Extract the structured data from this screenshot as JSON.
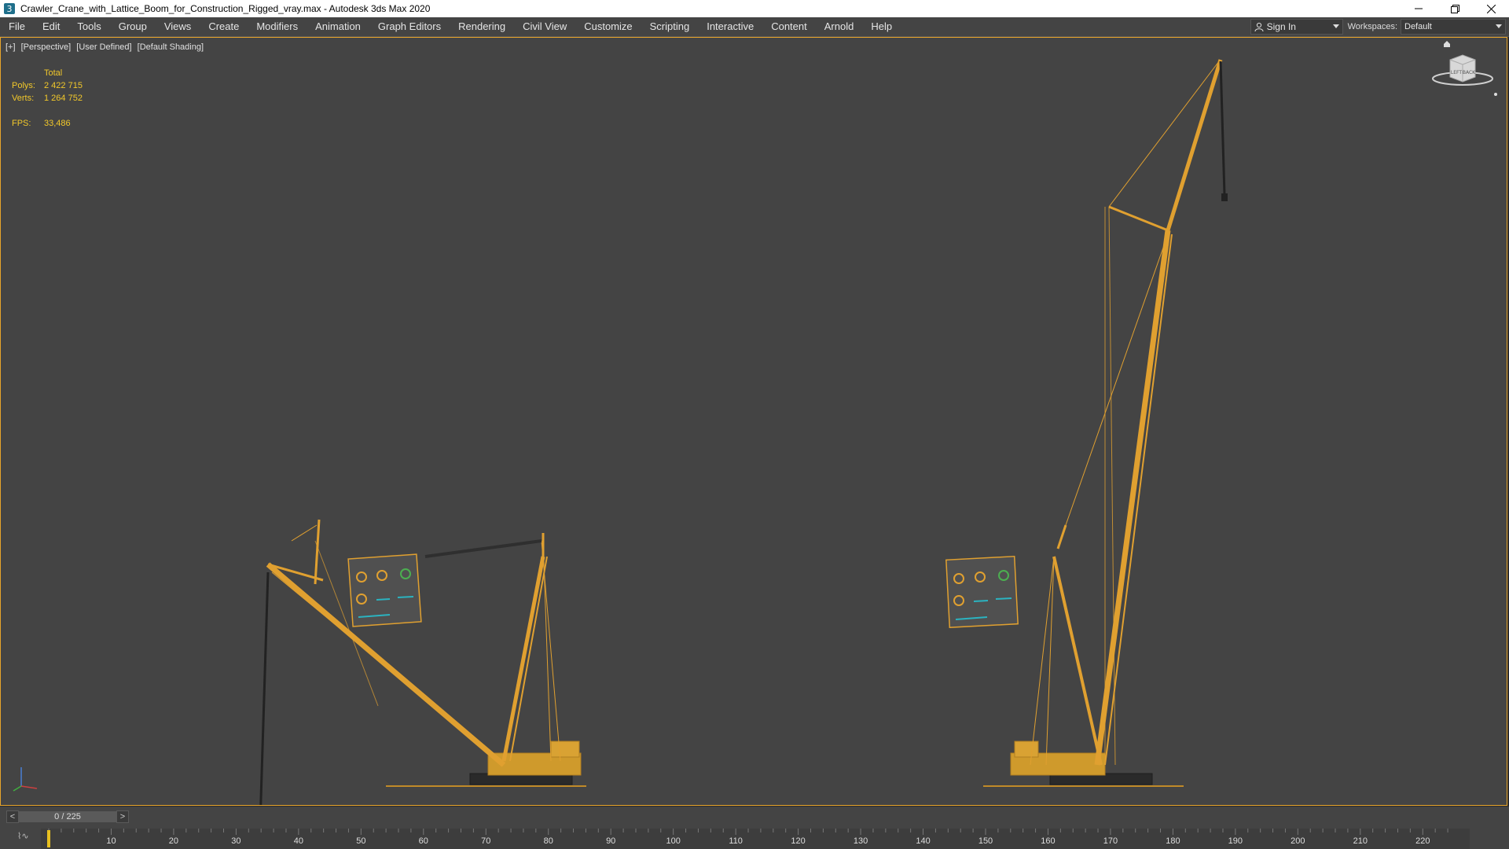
{
  "window": {
    "title": "Crawler_Crane_with_Lattice_Boom_for_Construction_Rigged_vray.max - Autodesk 3ds Max 2020"
  },
  "menu": [
    "File",
    "Edit",
    "Tools",
    "Group",
    "Views",
    "Create",
    "Modifiers",
    "Animation",
    "Graph Editors",
    "Rendering",
    "Civil View",
    "Customize",
    "Scripting",
    "Interactive",
    "Content",
    "Arnold",
    "Help"
  ],
  "account": {
    "sign_in": "Sign In"
  },
  "workspaces": {
    "label": "Workspaces:",
    "value": "Default"
  },
  "viewport": {
    "labels": [
      "[+]",
      "[Perspective]",
      "[User Defined]",
      "[Default Shading]"
    ],
    "stats": {
      "header": "Total",
      "polys_label": "Polys:",
      "polys_value": "2 422 715",
      "verts_label": "Verts:",
      "verts_value": "1 264 752",
      "fps_label": "FPS:",
      "fps_value": "33,486"
    },
    "viewcube": {
      "left": "LEFT",
      "back": "BACK"
    }
  },
  "timeline": {
    "prev": "<",
    "next": ">",
    "frame": "0 / 225",
    "ticks": [
      "10",
      "20",
      "30",
      "40",
      "50",
      "60",
      "70",
      "80",
      "90",
      "100",
      "110",
      "120",
      "130",
      "140",
      "150",
      "160",
      "170",
      "180",
      "190",
      "200",
      "210",
      "220"
    ]
  },
  "colors": {
    "accent": "#e8a52b",
    "crane": "#e0a030",
    "stats": "#f2c82a"
  }
}
